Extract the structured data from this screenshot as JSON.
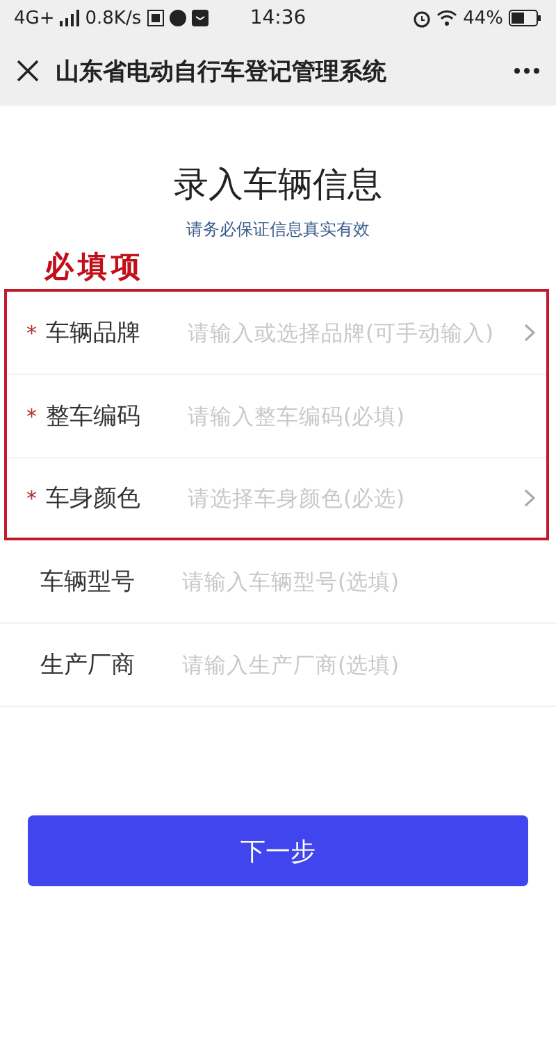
{
  "status_bar": {
    "network": "4G+",
    "speed": "0.8K/s",
    "time": "14:36",
    "battery": "44%"
  },
  "nav_bar": {
    "title": "山东省电动自行车登记管理系统"
  },
  "heading": "录入车辆信息",
  "subheading": "请务必保证信息真实有效",
  "annotation": {
    "text": "必填项"
  },
  "required_mark": "*",
  "fields": [
    {
      "label": "车辆品牌",
      "placeholder": "请输入或选择品牌(可手动输入)",
      "required": true,
      "kind": "select"
    },
    {
      "label": "整车编码",
      "placeholder": "请输入整车编码(必填)",
      "required": true,
      "kind": "input"
    },
    {
      "label": "车身颜色",
      "placeholder": "请选择车身颜色(必选)",
      "required": true,
      "kind": "select"
    },
    {
      "label": "车辆型号",
      "placeholder": "请输入车辆型号(选填)",
      "required": false,
      "kind": "input"
    },
    {
      "label": "生产厂商",
      "placeholder": "请输入生产厂商(选填)",
      "required": false,
      "kind": "input"
    }
  ],
  "next_button": "下一步"
}
